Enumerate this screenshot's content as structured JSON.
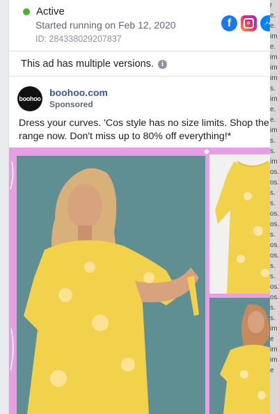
{
  "status": {
    "label": "Active",
    "color": "#42b72a"
  },
  "started": "Started running on Feb 12, 2020",
  "ad_id": "ID: 284338029207837",
  "platforms": [
    "facebook-icon",
    "instagram-icon",
    "messenger-icon"
  ],
  "versions_notice": "This ad has multiple versions.",
  "advertiser": {
    "name": "boohoo.com",
    "label": "Sponsored",
    "logo_text": "boohoo"
  },
  "ad_text": "Dress your curves. 'Cos style has no size limits. Shop the range now. Don't miss up to 80% off everything!*",
  "creative": {
    "background": "#e79ee3",
    "dress_color": "#f2d24a"
  },
  "right_edge_fragments": [
    "r",
    "e.",
    "e.",
    "im",
    "e.",
    "im",
    "im",
    "im",
    "s.",
    "im",
    "e.",
    "e.",
    "im",
    "s.",
    "s.",
    "im",
    "os.",
    "os.",
    "s.",
    "s.",
    "os.",
    "os.",
    "s.",
    "os.",
    "os.",
    "s.",
    "s.",
    "os.",
    "os.",
    "s.",
    "s.",
    "im",
    "e",
    "im",
    "im",
    "e"
  ]
}
